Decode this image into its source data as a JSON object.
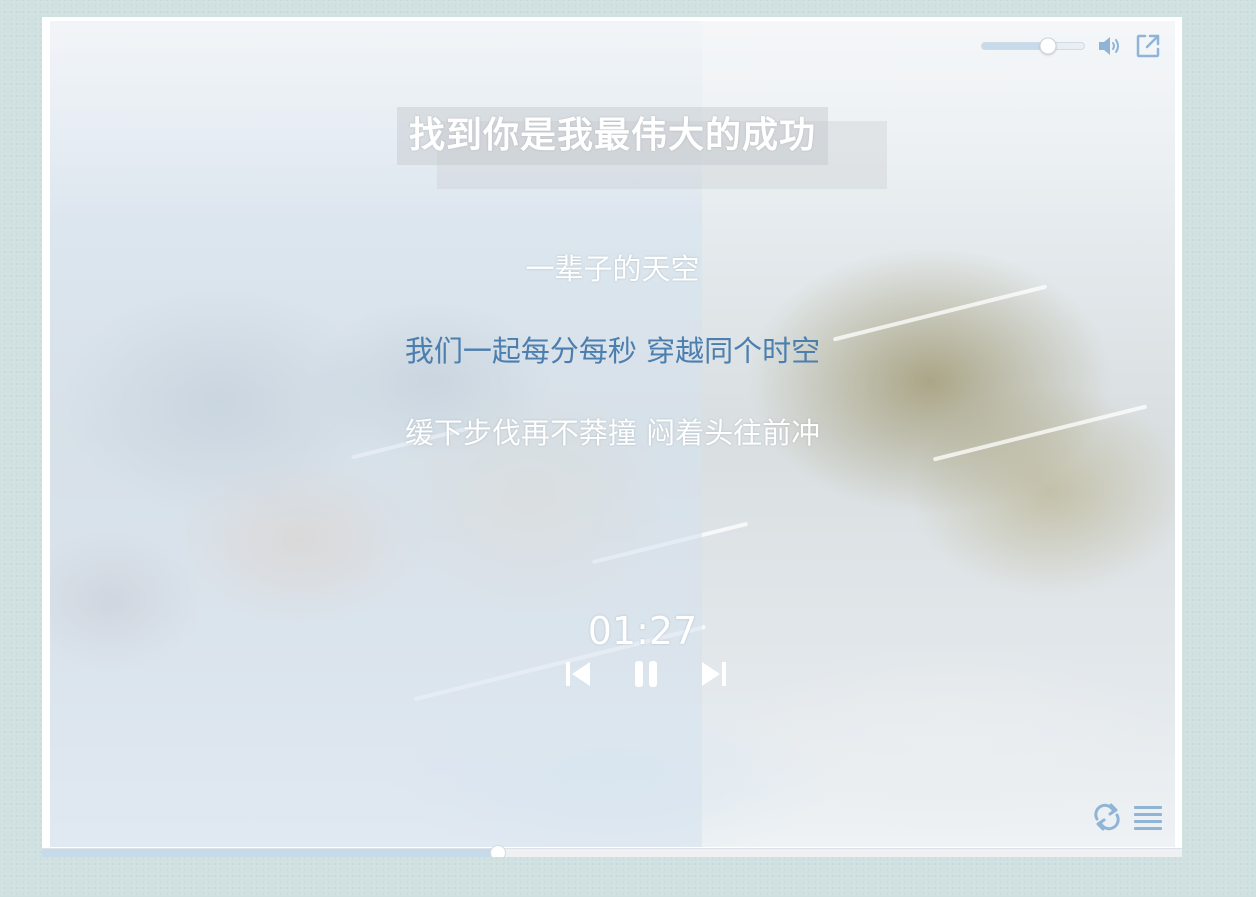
{
  "player": {
    "song_title": "找到你是我最伟大的成功",
    "lyrics": [
      {
        "text": "一辈子的天空",
        "active": false
      },
      {
        "text": "我们一起每分每秒 穿越同个时空",
        "active": true
      },
      {
        "text": "缓下步伐再不莽撞 闷着头往前冲",
        "active": false
      }
    ],
    "current_time": "01:27",
    "volume_level": 0.65,
    "progress_level": 0.4
  },
  "icons": {
    "volume": "speaker-icon",
    "external": "external-link-icon",
    "prev": "skip-previous-icon",
    "pause": "pause-icon",
    "next": "skip-next-icon",
    "loop": "repeat-icon",
    "playlist": "playlist-icon"
  },
  "colors": {
    "icon_blue": "#8fb4d6",
    "active_lyric": "#4c7eae",
    "progress_fill": "#c6daea"
  }
}
